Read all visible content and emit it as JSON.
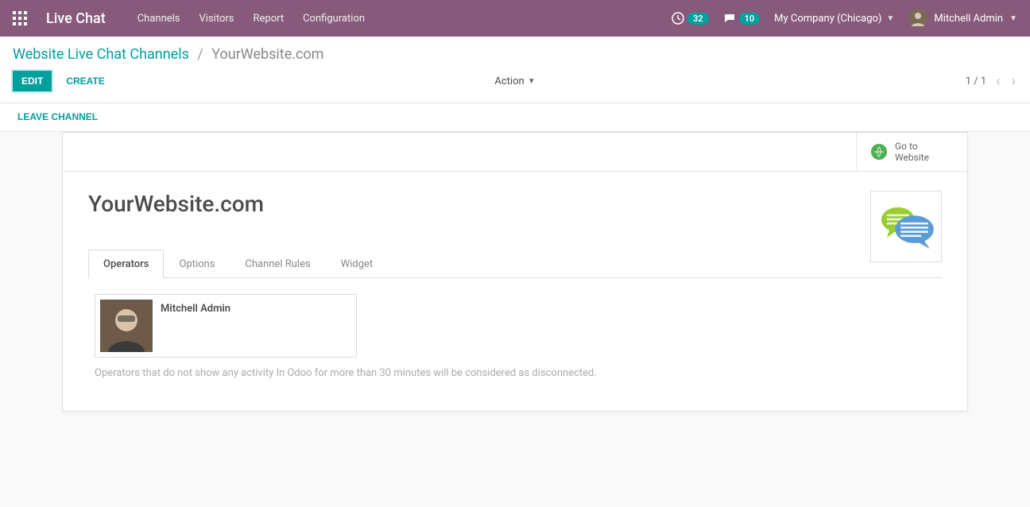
{
  "topbar": {
    "brand": "Live Chat",
    "menu": [
      "Channels",
      "Visitors",
      "Report",
      "Configuration"
    ],
    "activity_count": "32",
    "message_count": "10",
    "company": "My Company (Chicago)",
    "user": "Mitchell Admin"
  },
  "breadcrumb": {
    "root": "Website Live Chat Channels",
    "current": "YourWebsite.com"
  },
  "controls": {
    "edit": "EDIT",
    "create": "CREATE",
    "action": "Action",
    "pager": "1 / 1",
    "leave": "LEAVE CHANNEL"
  },
  "sheet": {
    "goto": "Go to Website",
    "title": "YourWebsite.com",
    "tabs": [
      "Operators",
      "Options",
      "Channel Rules",
      "Widget"
    ],
    "operator_name": "Mitchell Admin",
    "hint": "Operators that do not show any activity In Odoo for more than 30 minutes will be considered as disconnected."
  }
}
